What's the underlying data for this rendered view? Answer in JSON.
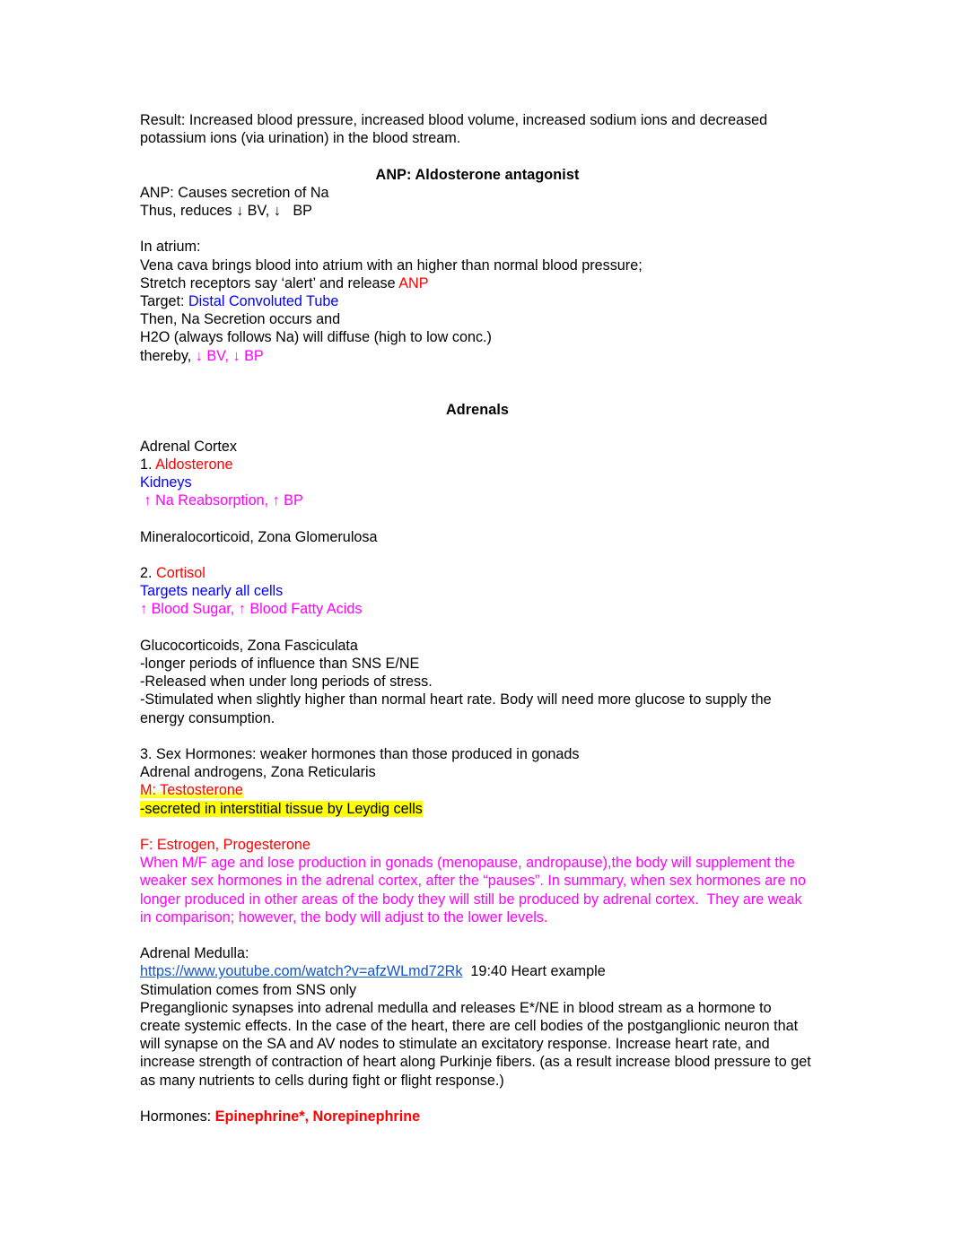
{
  "document": {
    "colors": {
      "red": "#ff0000",
      "blue": "#0000ff",
      "magenta": "#ff00ff",
      "highlight_yellow": "#ffff00",
      "link_blue": "#1155cc",
      "text_black": "#000000"
    },
    "blocks": {
      "result_paragraph": "Result: Increased blood pressure, increased blood volume, increased sodium ions and decreased potassium ions (via urination) in the blood stream.",
      "heading_anp": "ANP: Aldosterone antagonist",
      "anp_line1": "ANP: Causes secretion of Na",
      "anp_line2": "Thus, reduces ↓ BV, ↓   BP",
      "atrium_label": "In atrium:",
      "vena_cava_line": "Vena cava brings blood into atrium with an higher than normal blood pressure;",
      "stretch_receptors_prefix": "Stretch receptors say ‘alert’ and release ",
      "stretch_receptors_anp": "ANP",
      "target_prefix": "Target: ",
      "target_value": "Distal Convoluted Tube",
      "then_na_line": "Then, Na Secretion occurs and",
      "h2o_line": "H2O (always follows Na) will diffuse (high to low conc.)",
      "thereby_prefix": "thereby, ",
      "thereby_value": "↓ BV, ↓ BP",
      "heading_adrenals": "Adrenals",
      "adrenal_cortex_label": "Adrenal Cortex",
      "item1_number": "1. ",
      "item1_hormone": "Aldosterone",
      "item1_target": "Kidneys",
      "item1_effect": " ↑ Na Reabsorption, ↑ BP",
      "mineralocorticoid_line": "Mineralocorticoid, Zona Glomerulosa",
      "item2_number": "2. ",
      "item2_hormone": "Cortisol",
      "item2_target": "Targets nearly all cells",
      "item2_effect": "↑ Blood Sugar, ↑ Blood Fatty Acids",
      "glucocorticoids_line": "Glucocorticoids, Zona Fasciculata",
      "glucocorticoids_bullet1": "-longer periods of influence than SNS E/NE",
      "glucocorticoids_bullet2": "-Released when under long periods of stress.",
      "glucocorticoids_bullet3": "-Stimulated when slightly higher than normal heart rate. Body will need more glucose to supply the energy consumption.",
      "item3_line": "3. Sex Hormones: weaker hormones than those produced in gonads",
      "adrenal_androgens_line": "Adrenal androgens, Zona Reticularis",
      "male_hormone": "M: Testosterone",
      "male_hormone_note": "-secreted in interstitial tissue by Leydig cells",
      "female_hormones": "F: Estrogen, Progesterone",
      "female_paragraph": "When M/F age and lose production in gonads (menopause, andropause),the body will supplement the weaker sex hormones in the adrenal cortex, after the “pauses”. In summary, when sex hormones are no longer produced in other areas of the body they will still be produced by adrenal cortex.  They are weak in comparison; however, the body will adjust to the lower levels.",
      "adrenal_medulla_label": "Adrenal Medulla:",
      "video_url": "https://www.youtube.com/watch?v=afzWLmd72Rk",
      "video_timestamp_note": "  19:40 Heart example",
      "stimulation_line": "Stimulation comes from SNS only",
      "medulla_paragraph": "Preganglionic synapses into adrenal medulla and releases E*/NE in blood stream as a hormone to create systemic effects. In the case of the heart, there are cell bodies of the postganglionic neuron that will synapse on the SA and AV nodes to stimulate an excitatory response. Increase heart rate, and increase strength of contraction of heart along Purkinje fibers. (as a result increase blood pressure to get as many nutrients to cells during fight or flight response.)",
      "hormones_label": "Hormones: ",
      "hormones_value": "Epinephrine*, Norepinephrine"
    }
  }
}
